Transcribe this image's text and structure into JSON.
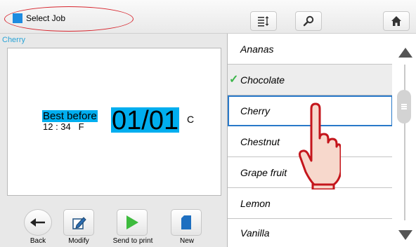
{
  "header": {
    "title": "Select Job",
    "icons": [
      "select-job-square",
      "sort-list-icon",
      "search-icon",
      "home-icon"
    ]
  },
  "job": {
    "name": "Cherry",
    "preview": {
      "best_before": "Best before",
      "time": "12 : 34   F",
      "date": "01/01",
      "code": "C"
    }
  },
  "toolbar": {
    "back_label": "Back",
    "modify_label": "Modify",
    "send_label": "Send to print",
    "new_label": "New"
  },
  "jobs_list": {
    "items": [
      {
        "label": "Ananas"
      },
      {
        "label": "Chocolate",
        "checked": true
      },
      {
        "label": "Cherry",
        "selected": true
      },
      {
        "label": "Chestnut"
      },
      {
        "label": "Grape fruit"
      },
      {
        "label": "Lemon"
      },
      {
        "label": "Vanilla"
      }
    ]
  },
  "colors": {
    "accent_blue": "#1e8be0",
    "highlight": "#00aeef",
    "selection_border": "#2979c9",
    "check_green": "#3cb54a",
    "annotation_red": "#d7262e"
  }
}
